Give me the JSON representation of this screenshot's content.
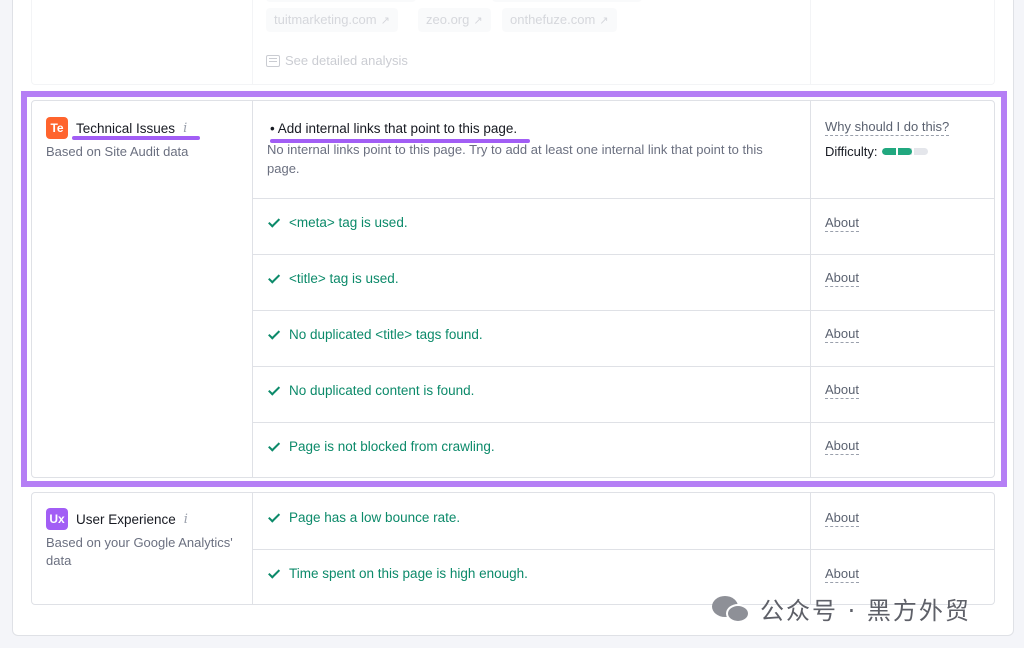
{
  "top_section": {
    "domains": [
      "tuitmarketing.com",
      "zeo.org",
      "onthefuze.com"
    ],
    "see_detailed_label": "See detailed analysis"
  },
  "technical": {
    "badge": "Te",
    "title": "Technical Issues",
    "info": "i",
    "subtitle": "Based on Site Audit data",
    "todo": {
      "title": "Add internal links that point to this page.",
      "description": "No internal links point to this page. Try to add at least one internal link that point to this page.",
      "why_label": "Why should I do this?",
      "difficulty_label": "Difficulty:",
      "difficulty_level": 0.66
    },
    "checks": [
      {
        "text": "<meta> tag is used.",
        "link": "About"
      },
      {
        "text": "<title> tag is used.",
        "link": "About"
      },
      {
        "text": "No duplicated <title> tags found.",
        "link": "About"
      },
      {
        "text": "No duplicated content is found.",
        "link": "About"
      },
      {
        "text": "Page is not blocked from crawling.",
        "link": "About"
      }
    ]
  },
  "ux": {
    "badge": "Ux",
    "title": "User Experience",
    "info": "i",
    "subtitle": "Based on your Google Analytics' data",
    "checks": [
      {
        "text": "Page has a low bounce rate.",
        "link": "About"
      },
      {
        "text": "Time spent on this page is high enough.",
        "link": "About"
      }
    ]
  },
  "colors": {
    "highlight": "#b57ff5",
    "underline": "#a25ef5",
    "success": "#0c8a6a",
    "tech_badge": "#ff642d",
    "ux_badge": "#a25ef5"
  },
  "watermark": "公众号 · 黑方外贸"
}
